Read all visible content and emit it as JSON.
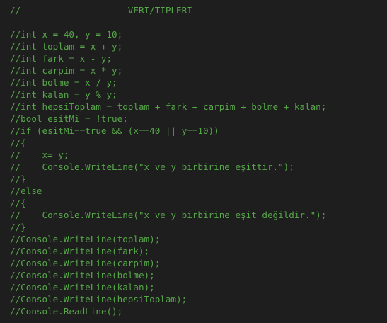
{
  "editor": {
    "comment_color": "#57a64a",
    "background_color": "#1e1e1e",
    "lines": [
      "//--------------------VERI/TIPLERI----------------",
      "",
      "//int x = 40, y = 10;",
      "//int toplam = x + y;",
      "//int fark = x - y;",
      "//int carpim = x * y;",
      "//int bolme = x / y;",
      "//int kalan = y % y;",
      "//int hepsiToplam = toplam + fark + carpim + bolme + kalan;",
      "//bool esitMi = !true;",
      "//if (esitMi==true && (x==40 || y==10))",
      "//{",
      "//    x= y;",
      "//    Console.WriteLine(\"x ve y birbirine eşittir.\");",
      "//}",
      "//else",
      "//{",
      "//    Console.WriteLine(\"x ve y birbirine eşit değildir.\");",
      "//}",
      "//Console.WriteLine(toplam);",
      "//Console.WriteLine(fark);",
      "//Console.WriteLine(carpim);",
      "//Console.WriteLine(bolme);",
      "//Console.WriteLine(kalan);",
      "//Console.WriteLine(hepsiToplam);",
      "//Console.ReadLine();"
    ]
  }
}
